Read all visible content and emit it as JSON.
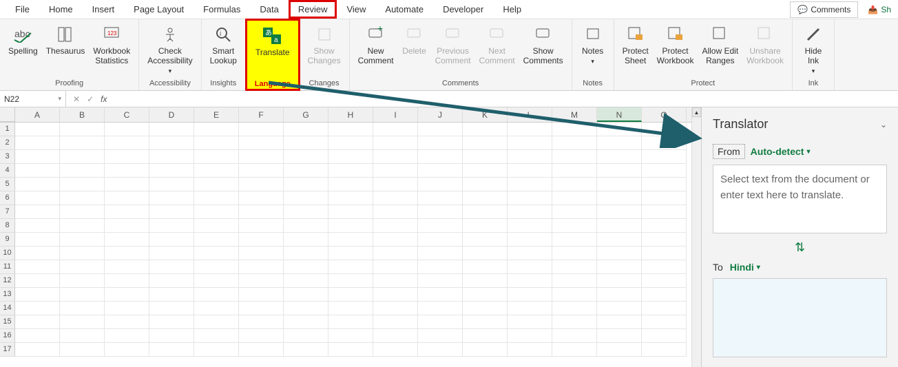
{
  "tabs": [
    "File",
    "Home",
    "Insert",
    "Page Layout",
    "Formulas",
    "Data",
    "Review",
    "View",
    "Automate",
    "Developer",
    "Help"
  ],
  "activeTab": "Review",
  "topRight": {
    "comments": "Comments",
    "share": "Sh"
  },
  "ribbon": {
    "proofing": {
      "label": "Proofing",
      "spelling": "Spelling",
      "thesaurus": "Thesaurus",
      "stats": "Workbook\nStatistics"
    },
    "accessibility": {
      "label": "Accessibility",
      "check": "Check\nAccessibility"
    },
    "insights": {
      "label": "Insights",
      "lookup": "Smart\nLookup"
    },
    "language": {
      "label": "Language",
      "translate": "Translate"
    },
    "changes": {
      "label": "Changes",
      "show": "Show\nChanges"
    },
    "comments": {
      "label": "Comments",
      "new": "New\nComment",
      "delete": "Delete",
      "prev": "Previous\nComment",
      "next": "Next\nComment",
      "show": "Show\nComments"
    },
    "notes": {
      "label": "Notes",
      "notes": "Notes"
    },
    "protect": {
      "label": "Protect",
      "sheet": "Protect\nSheet",
      "workbook": "Protect\nWorkbook",
      "ranges": "Allow Edit\nRanges",
      "unshare": "Unshare\nWorkbook"
    },
    "ink": {
      "label": "Ink",
      "hide": "Hide\nInk"
    }
  },
  "namebox": "N22",
  "columns": [
    "A",
    "B",
    "C",
    "D",
    "E",
    "F",
    "G",
    "H",
    "I",
    "J",
    "K",
    "L",
    "M",
    "N",
    "O"
  ],
  "selectedCol": "N",
  "rowCount": 17,
  "pane": {
    "title": "Translator",
    "fromLabel": "From",
    "fromLang": "Auto-detect",
    "placeholder": "Select text from the document or enter text here to translate.",
    "toLabel": "To",
    "toLang": "Hindi"
  }
}
